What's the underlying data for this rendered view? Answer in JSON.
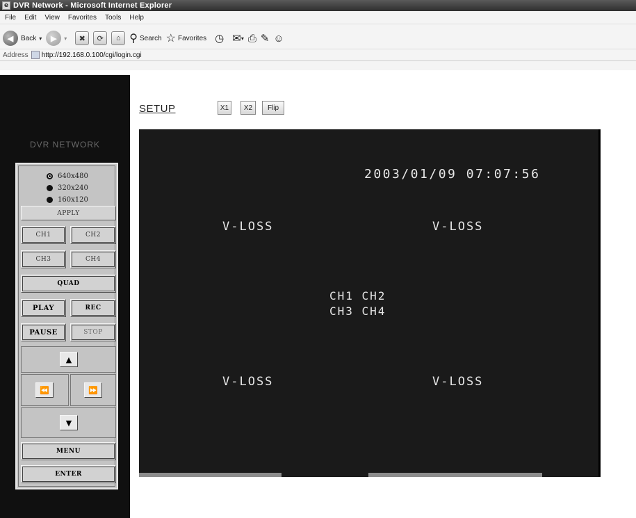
{
  "window": {
    "title": "DVR Network - Microsoft Internet Explorer"
  },
  "menu": [
    "File",
    "Edit",
    "View",
    "Favorites",
    "Tools",
    "Help"
  ],
  "toolbar": {
    "back_label": "Back",
    "search_label": "Search",
    "favorites_label": "Favorites"
  },
  "address": {
    "label": "Address",
    "url": "http://192.168.0.100/cgi/login.cgi"
  },
  "sidebar": {
    "logo": "DVR  NETWORK",
    "resolutions": [
      {
        "label": "640x480",
        "selected": true
      },
      {
        "label": "320x240",
        "selected": false
      },
      {
        "label": "160x120",
        "selected": false
      }
    ],
    "apply": "APPLY",
    "ch1": "CH1",
    "ch2": "CH2",
    "ch3": "CH3",
    "ch4": "CH4",
    "quad": "QUAD",
    "play": "PLAY",
    "rec": "REC",
    "pause": "PAUSE",
    "stop": "STOP",
    "menu": "MENU",
    "enter": "ENTER"
  },
  "topbar": {
    "setup": "SETUP",
    "x1": "X1",
    "x2": "X2",
    "flip": "Flip"
  },
  "video": {
    "timestamp": "2003/01/09  07:07:56",
    "vloss_tl": "V-LOSS",
    "vloss_tr": "V-LOSS",
    "vloss_bl": "V-LOSS",
    "vloss_br": "V-LOSS",
    "ch_line1": "CH1  CH2",
    "ch_line2": "CH3  CH4"
  }
}
